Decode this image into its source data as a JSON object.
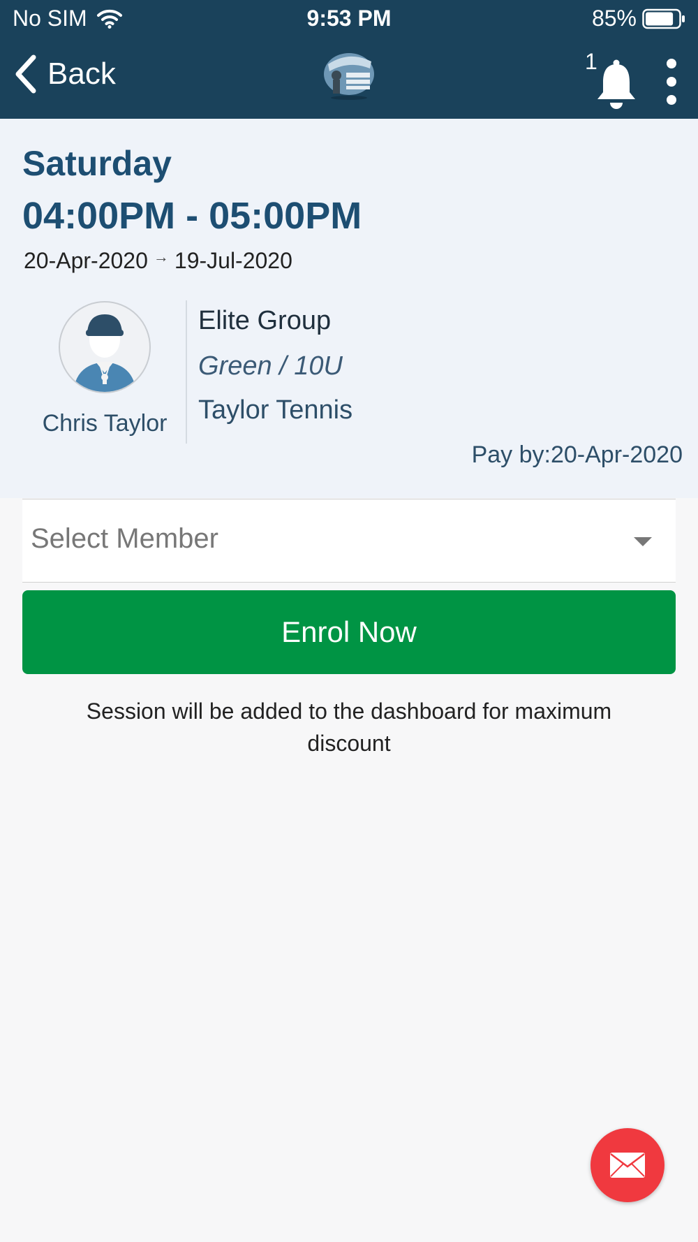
{
  "status_bar": {
    "carrier": "No SIM",
    "time": "9:53 PM",
    "battery_percent": "85%",
    "battery_level": 0.85
  },
  "nav": {
    "back_label": "Back",
    "notification_count": "1",
    "icons": {
      "back": "chevron-left-icon",
      "bell": "bell-icon",
      "menu": "more-vertical-icon",
      "logo": "taylor-tennis-logo"
    }
  },
  "session": {
    "day": "Saturday",
    "time_range": "04:00PM - 05:00PM",
    "start_date": "20-Apr-2020",
    "date_arrow": "→",
    "end_date": "19-Jul-2020",
    "coach_name": "Chris Taylor",
    "group_name": "Elite Group",
    "level": "Green / 10U",
    "academy": "Taylor Tennis",
    "pay_by": "Pay by:20-Apr-2020"
  },
  "form": {
    "select_placeholder": "Select Member",
    "enrol_label": "Enrol Now",
    "note": "Session will be added to the dashboard for maximum discount"
  },
  "fab": {
    "icon": "mail-icon"
  },
  "colors": {
    "header": "#1a425b",
    "primary_text": "#1d4e72",
    "card_bg": "#eff3f9",
    "enrol_green": "#009444",
    "fab_red": "#f0393f"
  }
}
